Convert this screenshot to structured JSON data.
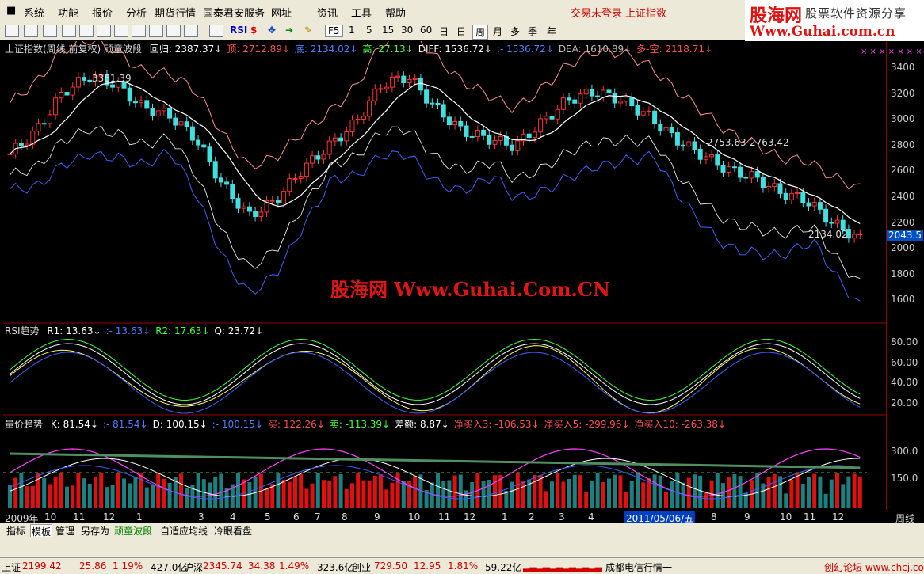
{
  "menu": {
    "items": [
      "系统",
      "功能",
      "报价",
      "分析",
      "期货行情",
      "国泰君安服务",
      "网址",
      "资讯",
      "工具",
      "帮助"
    ],
    "trade_status": "交易未登录",
    "index_name": "上证指数"
  },
  "branding": {
    "logo": "股海网",
    "tagline": "股票软件资源分享",
    "url": "Www.Guhai.com.cn",
    "watermark": "股海网 Www.Guhai.Com.CN"
  },
  "toolbar": {
    "icons": [
      "grid-icon",
      "table-icon",
      "line-chart-icon",
      "candle-icon",
      "f10-icon",
      "f11-icon",
      "f12-icon",
      "f13-icon",
      "search-icon",
      "wave-icon",
      "rsi-icon",
      "dollar-icon",
      "move-icon",
      "arrow-icon",
      "pen-icon"
    ],
    "rsi": "RSI",
    "periods": [
      "F5",
      "1",
      "5",
      "15",
      "30",
      "60",
      "日",
      "周",
      "月",
      "多",
      "季",
      "年"
    ],
    "selected_period": "周"
  },
  "main_panel": {
    "title": "上证指数(周线 前复权) 顽童波段",
    "values": [
      {
        "label": "回归:",
        "value": "2387.37",
        "color": "#ffffff"
      },
      {
        "label": "顶:",
        "value": "2712.89",
        "color": "#ff5050"
      },
      {
        "label": "底:",
        "value": "2134.02",
        "color": "#4f7dff"
      },
      {
        "label": "高:",
        "value": "27.13",
        "color": "#40ff40"
      },
      {
        "label": "DIFF:",
        "value": "1536.72",
        "color": "#ffffff"
      },
      {
        "label": ":-",
        "value": "1536.72",
        "color": "#4f7dff"
      },
      {
        "label": "DEA:",
        "value": "1610.89",
        "color": "#bbbbbb"
      },
      {
        "label": "多-空:",
        "value": "2118.71",
        "color": "#ff5050"
      }
    ],
    "annotations": {
      "high": "3361.39",
      "mid": "2753.63-2763.42",
      "low": "2134.02"
    },
    "axis_ticks": [
      "3400",
      "3200",
      "3000",
      "2800",
      "2600",
      "2400",
      "2200",
      "2000",
      "1800",
      "1600"
    ],
    "current_price": "2043.5"
  },
  "rsi_panel": {
    "title": "RSI趋势",
    "values": [
      {
        "label": "R1:",
        "value": "13.63",
        "color": "#ffffff"
      },
      {
        "label": ":-",
        "value": "13.63",
        "color": "#4f7dff"
      },
      {
        "label": "R2:",
        "value": "17.63",
        "color": "#40ff40"
      },
      {
        "label": "Q:",
        "value": "23.72",
        "color": "#ffffff"
      }
    ],
    "axis_ticks": [
      "80.00",
      "60.00",
      "40.00",
      "20.00"
    ]
  },
  "volume_panel": {
    "title": "量价趋势",
    "values": [
      {
        "label": "K:",
        "value": "81.54",
        "color": "#ffffff"
      },
      {
        "label": ":-",
        "value": "81.54",
        "color": "#4f7dff"
      },
      {
        "label": "D:",
        "value": "100.15",
        "color": "#ffffff"
      },
      {
        "label": ":-",
        "value": "100.15",
        "color": "#4f7dff"
      },
      {
        "label": "买:",
        "value": "122.26",
        "color": "#ff5050"
      },
      {
        "label": "卖:",
        "value": "-113.39",
        "color": "#40ff40"
      },
      {
        "label": "差额:",
        "value": "8.87",
        "color": "#ffffff"
      },
      {
        "label": "净买入3:",
        "value": "-106.53",
        "color": "#ff5050"
      },
      {
        "label": "净买入5:",
        "value": "-299.96",
        "color": "#ff5050"
      },
      {
        "label": "净买入10:",
        "value": "-263.38",
        "color": "#ff5050"
      }
    ],
    "axis_ticks": [
      "300.0",
      "150.0"
    ]
  },
  "date_axis": {
    "labels": [
      "2009年",
      "10",
      "11",
      "12",
      "1",
      "3",
      "4",
      "5",
      "6",
      "7",
      "8",
      "9",
      "10",
      "11",
      "12",
      "1",
      "2",
      "3",
      "4",
      "8",
      "9",
      "10",
      "11",
      "12"
    ],
    "cursor_date": "2011/05/06/五",
    "period": "周线"
  },
  "tabs": [
    "指标",
    "模板",
    "管理",
    "另存为",
    "顽童波段",
    "自适应均线",
    "冷眼看盘"
  ],
  "status": {
    "sh_label": "上证",
    "sh_value": "2199.42",
    "sh_change": "25.86",
    "sh_pct": "1.19%",
    "sh_amount": "427.0亿",
    "hs_label": "沪深",
    "hs_value": "2345.74",
    "hs_change": "34.38",
    "hs_pct": "1.49%",
    "hs_amount": "323.6亿",
    "cy_label": "创业",
    "cy_value": "729.50",
    "cy_change": "12.95",
    "cy_pct": "1.81%",
    "cy_amount": "59.22亿",
    "news": "成都电信行情一",
    "site": "创幻论坛 www.chcj.com"
  }
}
